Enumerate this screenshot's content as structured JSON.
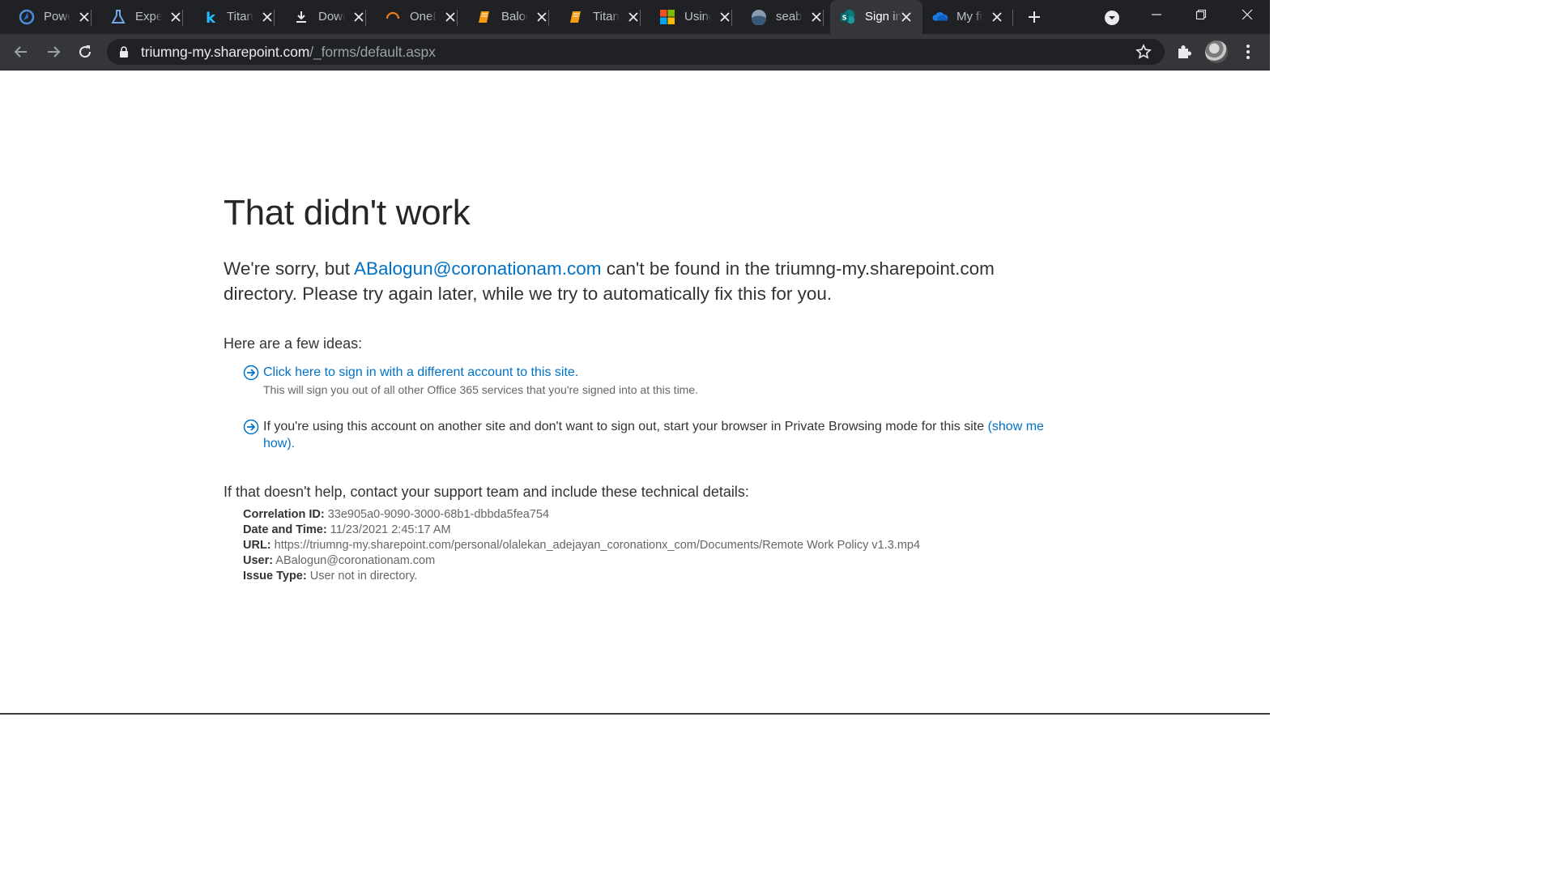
{
  "browser": {
    "tabs": [
      {
        "title": "Power",
        "icon": "power-automate-icon",
        "active": false
      },
      {
        "title": "Experiments",
        "icon": "flask-icon",
        "active": false
      },
      {
        "title": "Titanic",
        "icon": "kaggle-icon",
        "active": false
      },
      {
        "title": "Downloads",
        "icon": "download-icon",
        "active": false
      },
      {
        "title": "OneDrive",
        "icon": "loading-spinner-icon",
        "active": false
      },
      {
        "title": "Balogun",
        "icon": "notebook-icon",
        "active": false
      },
      {
        "title": "Titanic",
        "icon": "notebook-icon",
        "active": false
      },
      {
        "title": "Using",
        "icon": "microsoft-logo-icon",
        "active": false
      },
      {
        "title": "seaborn",
        "icon": "seaborn-icon",
        "active": false
      },
      {
        "title": "Sign in",
        "icon": "sharepoint-icon",
        "active": true
      },
      {
        "title": "My files",
        "icon": "onedrive-cloud-icon",
        "active": false
      }
    ],
    "address": {
      "host": "triumng-my.sharepoint.com",
      "path": "/_forms/default.aspx"
    }
  },
  "page": {
    "heading": "That didn't work",
    "message_prefix": "We're sorry, but ",
    "account_email": "ABalogun@coronationam.com",
    "message_suffix": " can't be found in the triumng-my.sharepoint.com directory. Please try again later, while we try to automatically fix this for you.",
    "ideas_heading": "Here are a few ideas:",
    "idea1_link": "Click here to sign in with a different account to this site.",
    "idea1_note": "This will sign you out of all other Office 365 services that you're signed into at this time.",
    "idea2_text": "If you're using this account on another site and don't want to sign out, start your browser in Private Browsing mode for this site ",
    "idea2_link": "(show me how).",
    "help_text": "If that doesn't help, contact your support team and include these technical details:",
    "details": {
      "correlation_label": "Correlation ID:",
      "correlation_value": " 33e905a0-9090-3000-68b1-dbbda5fea754",
      "date_label": "Date and Time:",
      "date_value": " 11/23/2021 2:45:17 AM",
      "url_label": "URL:",
      "url_value": " https://triumng-my.sharepoint.com/personal/olalekan_adejayan_coronationx_com/Documents/Remote Work Policy v1.3.mp4",
      "user_label": "User:",
      "user_value": " ABalogun@coronationam.com",
      "issue_label": "Issue Type:",
      "issue_value": " User not in directory."
    }
  },
  "colors": {
    "link": "#0072c6",
    "titlebar": "#202124",
    "toolbar": "#35363a"
  }
}
